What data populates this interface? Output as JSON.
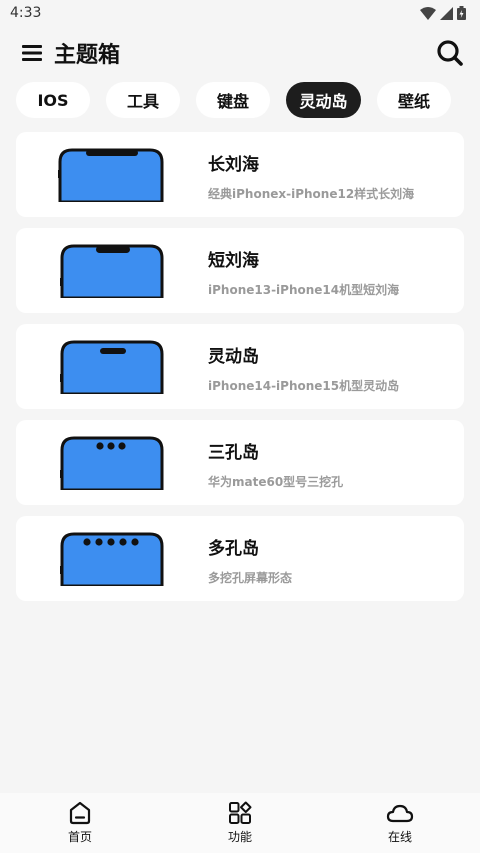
{
  "status_bar": {
    "time": "4:33"
  },
  "header": {
    "title": "主题箱"
  },
  "tabs": [
    {
      "label": "IOS",
      "active": false
    },
    {
      "label": "工具",
      "active": false
    },
    {
      "label": "键盘",
      "active": false
    },
    {
      "label": "灵动岛",
      "active": true
    },
    {
      "label": "壁纸",
      "active": false
    }
  ],
  "cards": [
    {
      "title": "长刘海",
      "subtitle": "经典iPhonex-iPhone12样式长刘海",
      "cutout": "long-notch"
    },
    {
      "title": "短刘海",
      "subtitle": "iPhone13-iPhone14机型短刘海",
      "cutout": "short-notch"
    },
    {
      "title": "灵动岛",
      "subtitle": "iPhone14-iPhone15机型灵动岛",
      "cutout": "dynamic-island"
    },
    {
      "title": "三孔岛",
      "subtitle": "华为mate60型号三挖孔",
      "cutout": "three-holes"
    },
    {
      "title": "多孔岛",
      "subtitle": "多挖孔屏幕形态",
      "cutout": "five-holes"
    }
  ],
  "bottom_nav": [
    {
      "label": "首页",
      "icon": "home-icon"
    },
    {
      "label": "功能",
      "icon": "apps-icon"
    },
    {
      "label": "在线",
      "icon": "cloud-icon"
    }
  ],
  "colors": {
    "screen": "#3d8ef0",
    "active_tab": "#1d1d1d"
  }
}
